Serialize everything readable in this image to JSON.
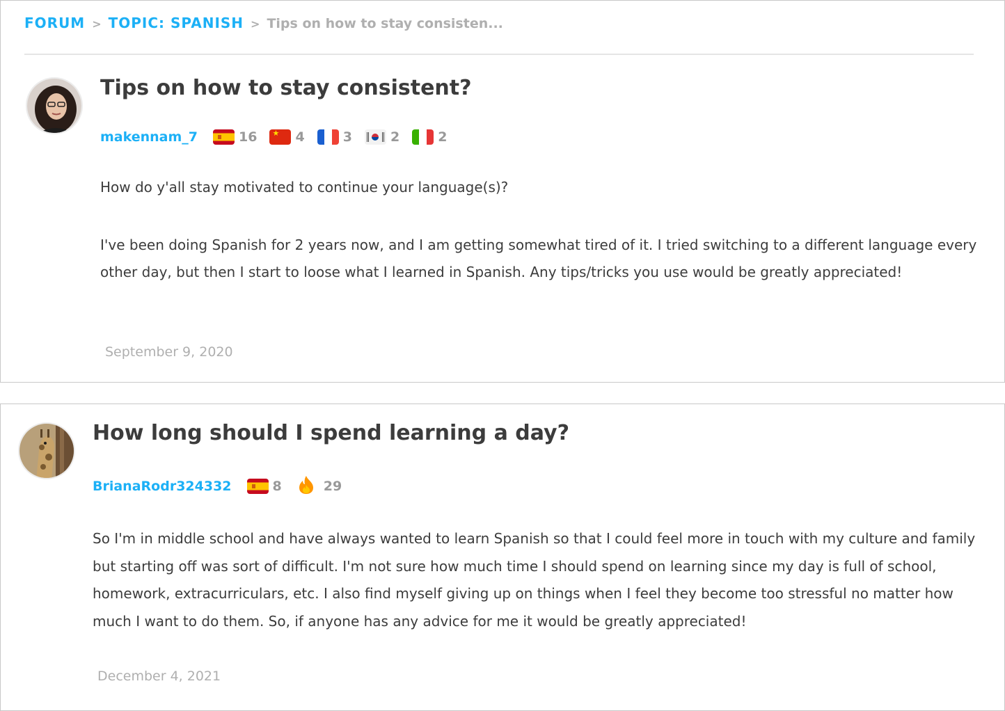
{
  "breadcrumb": {
    "forum": "FORUM",
    "topic": "TOPIC: SPANISH",
    "current": "Tips on how to stay consisten...",
    "separator": ">"
  },
  "posts": [
    {
      "title": "Tips on how to stay consistent?",
      "username": "makennam_7",
      "languages": [
        {
          "flag": "spain-flag-icon",
          "level": "16"
        },
        {
          "flag": "china-flag-icon",
          "level": "4"
        },
        {
          "flag": "france-flag-icon",
          "level": "3"
        },
        {
          "flag": "korea-flag-icon",
          "level": "2"
        },
        {
          "flag": "italy-flag-icon",
          "level": "2"
        }
      ],
      "paragraphs": [
        "How do y'all stay motivated to continue your language(s)?",
        "I've been doing Spanish for 2 years now, and I am getting somewhat tired of it. I tried switching to a different language every other day, but then I start to loose what I learned in Spanish. Any tips/tricks you use would be greatly appreciated!"
      ],
      "date": "September 9, 2020"
    },
    {
      "title": "How long should I spend learning a day?",
      "username": "BrianaRodr324332",
      "languages": [
        {
          "flag": "spain-flag-icon",
          "level": "8"
        }
      ],
      "streak": {
        "icon": "flame-icon",
        "days": "29"
      },
      "paragraphs": [
        "So I'm in middle school and have always wanted to learn Spanish so that I could feel more in touch with my culture and family but starting off was sort of difficult. I'm not sure how much time I should spend on learning since my day is full of school, homework, extracurriculars, etc. I also find myself giving up on things when I feel they become too stressful no matter how much I want to do them. So, if anyone has any advice for me it would be greatly appreciated!"
      ],
      "date": "December 4, 2021"
    }
  ],
  "colors": {
    "link_blue": "#1cb0f6",
    "text": "#3c3c3c",
    "muted": "#afafaf",
    "flame": "#ff9600"
  }
}
